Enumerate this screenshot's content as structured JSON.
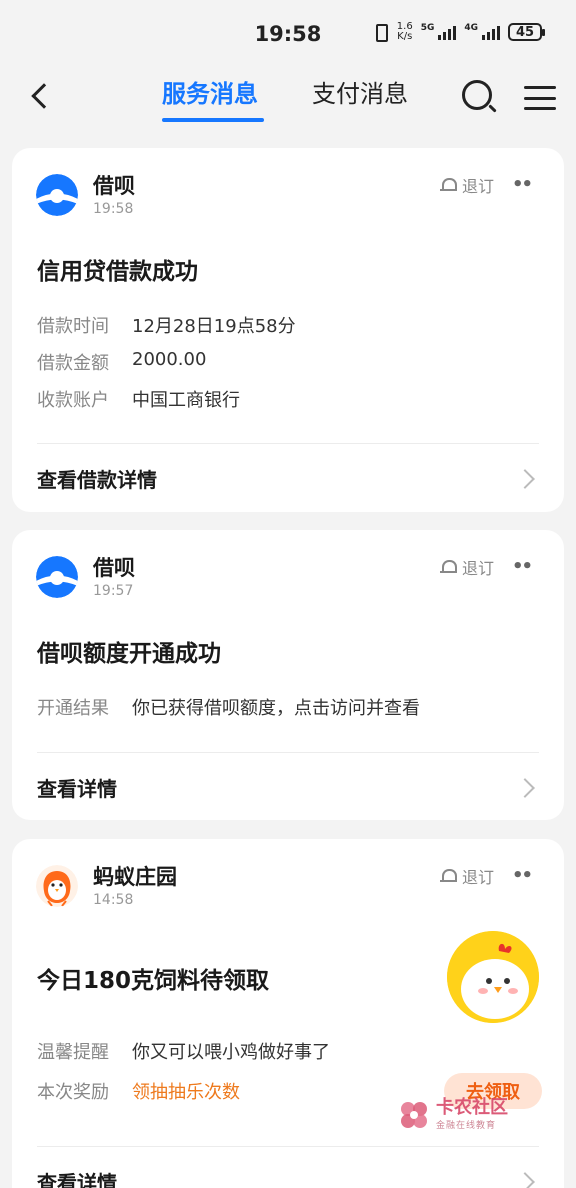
{
  "status_bar": {
    "time": "19:58",
    "net_speed_value": "1.6",
    "net_speed_unit": "K/s",
    "net1": "5G",
    "net2": "4G",
    "battery": "45"
  },
  "nav": {
    "tabs": [
      {
        "label": "服务消息",
        "active": true
      },
      {
        "label": "支付消息",
        "active": false
      }
    ]
  },
  "unsubscribe_label": "退订",
  "more_label": "••",
  "cards": [
    {
      "sender": "借呗",
      "time": "19:58",
      "title": "信用贷借款成功",
      "fields": [
        {
          "key": "借款时间",
          "value": "12月28日19点58分"
        },
        {
          "key": "借款金额",
          "value": "2000.00"
        },
        {
          "key": "收款账户",
          "value": "中国工商银行"
        }
      ],
      "footer": "查看借款详情"
    },
    {
      "sender": "借呗",
      "time": "19:57",
      "title": "借呗额度开通成功",
      "fields": [
        {
          "key": "开通结果",
          "value": "你已获得借呗额度，点击访问并查看"
        }
      ],
      "footer": "查看详情"
    },
    {
      "sender": "蚂蚁庄园",
      "time": "14:58",
      "title": "今日180克饲料待领取",
      "fields": [
        {
          "key": "温馨提醒",
          "value": "你又可以喂小鸡做好事了"
        },
        {
          "key": "本次奖励",
          "value": "领抽抽乐次数"
        }
      ],
      "button": "去领取",
      "footer": "查看详情"
    }
  ],
  "watermark": {
    "title": "卡农社区",
    "subtitle": "金融在线教育"
  },
  "colors": {
    "accent": "#1677ff",
    "orange": "#ee7a1e",
    "background": "#f3f3f3"
  }
}
